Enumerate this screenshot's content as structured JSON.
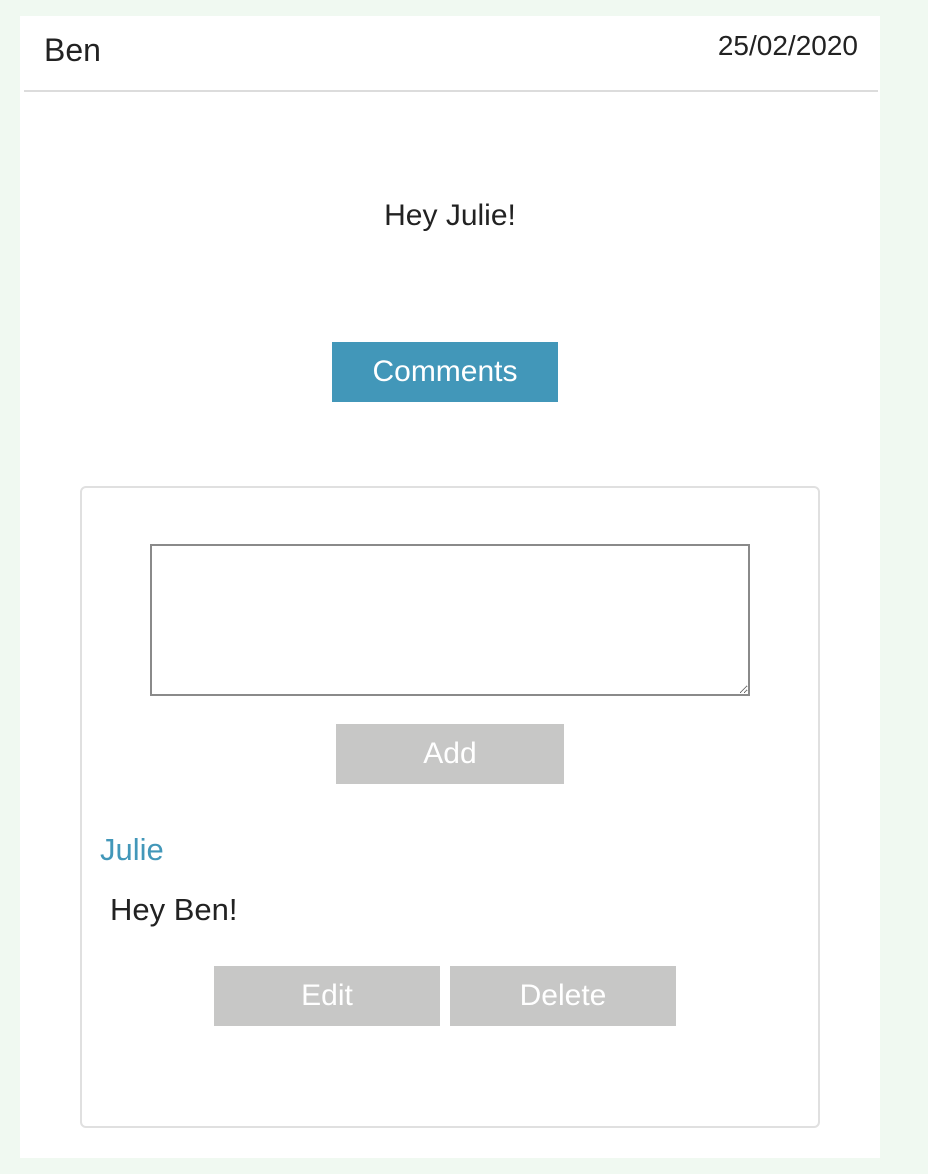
{
  "post": {
    "author": "Ben",
    "date": "25/02/2020",
    "message": "Hey Julie!",
    "comments_button_label": "Comments"
  },
  "comment_form": {
    "value": "",
    "add_label": "Add"
  },
  "comments": [
    {
      "author": "Julie",
      "text": "Hey Ben!",
      "edit_label": "Edit",
      "delete_label": "Delete"
    }
  ],
  "colors": {
    "page_background": "#f0f9f1",
    "accent": "#4297b9",
    "disabled_button": "#c7c7c6"
  }
}
